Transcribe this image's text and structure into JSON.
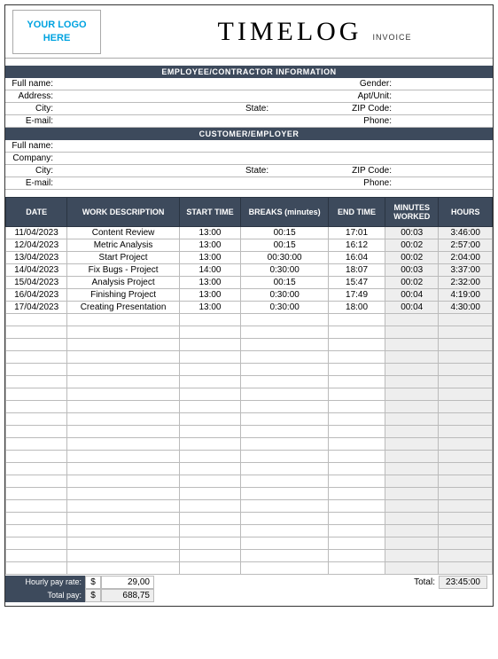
{
  "header": {
    "logo_line1": "YOUR LOGO",
    "logo_line2": "HERE",
    "title": "TIMELOG",
    "subtitle": "INVOICE"
  },
  "sections": {
    "employee_header": "EMPLOYEE/CONTRACTOR INFORMATION",
    "customer_header": "CUSTOMER/EMPLOYER"
  },
  "employee": {
    "full_name_lbl": "Full name:",
    "address_lbl": "Address:",
    "city_lbl": "City:",
    "email_lbl": "E-mail:",
    "gender_lbl": "Gender:",
    "apt_lbl": "Apt/Unit:",
    "state_lbl": "State:",
    "zip_lbl": "ZIP Code:",
    "phone_lbl": "Phone:",
    "full_name": "",
    "address": "",
    "city": "",
    "email": "",
    "gender": "",
    "apt": "",
    "state": "",
    "zip": "",
    "phone": ""
  },
  "customer": {
    "full_name_lbl": "Full name:",
    "company_lbl": "Company:",
    "city_lbl": "City:",
    "email_lbl": "E-mail:",
    "state_lbl": "State:",
    "zip_lbl": "ZIP Code:",
    "phone_lbl": "Phone:",
    "full_name": "",
    "company": "",
    "city": "",
    "email": "",
    "state": "",
    "zip": "",
    "phone": ""
  },
  "columns": {
    "date": "DATE",
    "desc": "WORK DESCRIPTION",
    "start": "START TIME",
    "breaks": "BREAKS (minutes)",
    "end": "END TIME",
    "minutes": "MINUTES WORKED",
    "hours": "HOURS"
  },
  "chart_data": {
    "type": "table",
    "rows": [
      {
        "date": "11/04/2023",
        "desc": "Content Review",
        "start": "13:00",
        "breaks": "00:15",
        "end": "17:01",
        "minutes": "00:03",
        "hours": "3:46:00"
      },
      {
        "date": "12/04/2023",
        "desc": "Metric Analysis",
        "start": "13:00",
        "breaks": "00:15",
        "end": "16:12",
        "minutes": "00:02",
        "hours": "2:57:00"
      },
      {
        "date": "13/04/2023",
        "desc": "Start Project",
        "start": "13:00",
        "breaks": "00:30:00",
        "end": "16:04",
        "minutes": "00:02",
        "hours": "2:04:00"
      },
      {
        "date": "14/04/2023",
        "desc": "Fix Bugs - Project",
        "start": "14:00",
        "breaks": "0:30:00",
        "end": "18:07",
        "minutes": "00:03",
        "hours": "3:37:00"
      },
      {
        "date": "15/04/2023",
        "desc": "Analysis Project",
        "start": "13:00",
        "breaks": "00:15",
        "end": "15:47",
        "minutes": "00:02",
        "hours": "2:32:00"
      },
      {
        "date": "16/04/2023",
        "desc": "Finishing Project",
        "start": "13:00",
        "breaks": "0:30:00",
        "end": "17:49",
        "minutes": "00:04",
        "hours": "4:19:00"
      },
      {
        "date": "17/04/2023",
        "desc": "Creating Presentation",
        "start": "13:00",
        "breaks": "0:30:00",
        "end": "18:00",
        "minutes": "00:04",
        "hours": "4:30:00"
      }
    ],
    "empty_rows": 21
  },
  "totals": {
    "total_lbl": "Total:",
    "total_hours": "23:45:00",
    "hourly_lbl": "Hourly pay rate:",
    "totalpay_lbl": "Total pay:",
    "currency": "$",
    "hourly_rate": "29,00",
    "total_pay": "688,75"
  }
}
